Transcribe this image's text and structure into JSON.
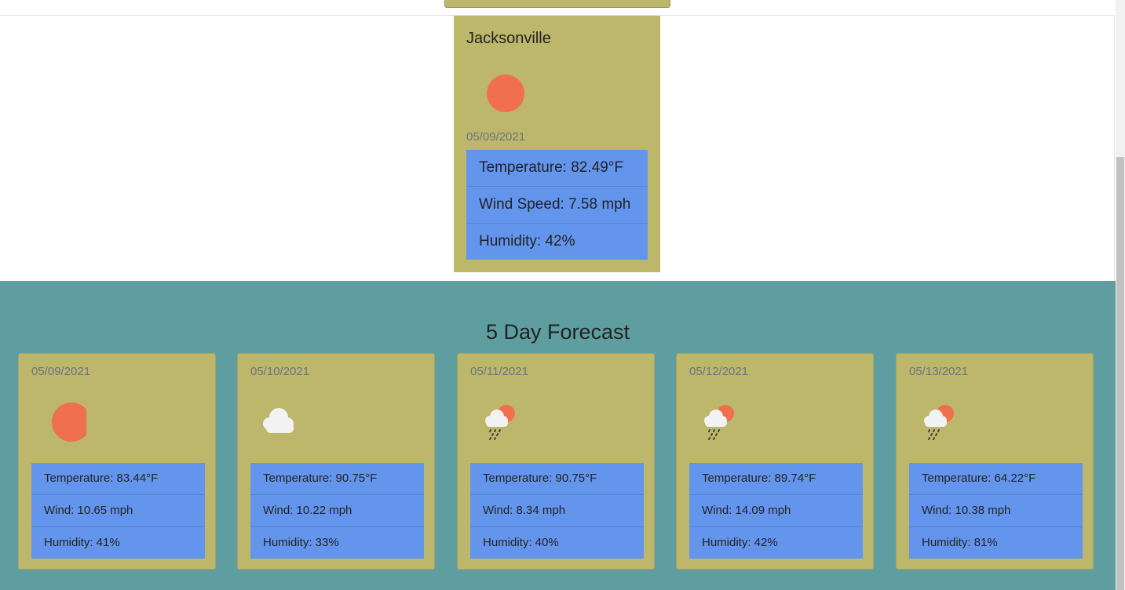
{
  "current": {
    "city": "Jacksonville",
    "icon": "sun-icon",
    "date": "05/09/2021",
    "temperature": "Temperature: 82.49°F",
    "wind": "Wind Speed: 7.58 mph",
    "humidity": "Humidity: 42%"
  },
  "forecast": {
    "title": "5 Day Forecast",
    "days": [
      {
        "date": "05/09/2021",
        "icon": "sun-icon",
        "temperature": "Temperature: 83.44°F",
        "wind": "Wind: 10.65 mph",
        "humidity": "Humidity: 41%"
      },
      {
        "date": "05/10/2021",
        "icon": "cloud-icon",
        "temperature": "Temperature: 90.75°F",
        "wind": "Wind: 10.22 mph",
        "humidity": "Humidity: 33%"
      },
      {
        "date": "05/11/2021",
        "icon": "rain-sun-icon",
        "temperature": "Temperature: 90.75°F",
        "wind": "Wind: 8.34 mph",
        "humidity": "Humidity: 40%"
      },
      {
        "date": "05/12/2021",
        "icon": "rain-sun-icon",
        "temperature": "Temperature: 89.74°F",
        "wind": "Wind: 14.09 mph",
        "humidity": "Humidity: 42%"
      },
      {
        "date": "05/13/2021",
        "icon": "rain-sun-icon",
        "temperature": "Temperature: 64.22°F",
        "wind": "Wind: 10.38 mph",
        "humidity": "Humidity: 81%"
      }
    ]
  },
  "colors": {
    "card": "#bdb76b",
    "list": "#6495ed",
    "section": "#5f9ea0",
    "sun": "#ef6f4f"
  }
}
